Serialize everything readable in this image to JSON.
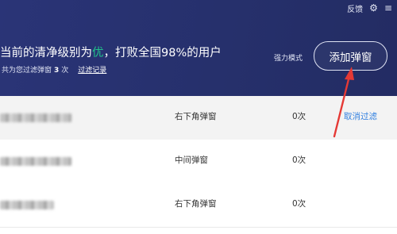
{
  "topbar": {
    "feedback": "反馈",
    "settings_icon": "gear-icon"
  },
  "header": {
    "headline_prefix": "当前的清净级别为",
    "level": "优",
    "headline_suffix": "，打败全国98%的用户",
    "sub_prefix": "共为您过滤弹窗",
    "filtered_count": "3",
    "sub_unit": "次",
    "records_link": "过滤记录",
    "mode_label": "强力模式",
    "add_button": "添加弹窗"
  },
  "rows": [
    {
      "type": "右下角弹窗",
      "count": "0次",
      "action": "取消过滤"
    },
    {
      "type": "中间弹窗",
      "count": "0次",
      "action": ""
    },
    {
      "type": "右下角弹窗",
      "count": "0次",
      "action": ""
    }
  ],
  "colors": {
    "header_bg": "#26306c",
    "level": "#20c48a",
    "link": "#2f7fe0",
    "arrow": "#e53935"
  }
}
